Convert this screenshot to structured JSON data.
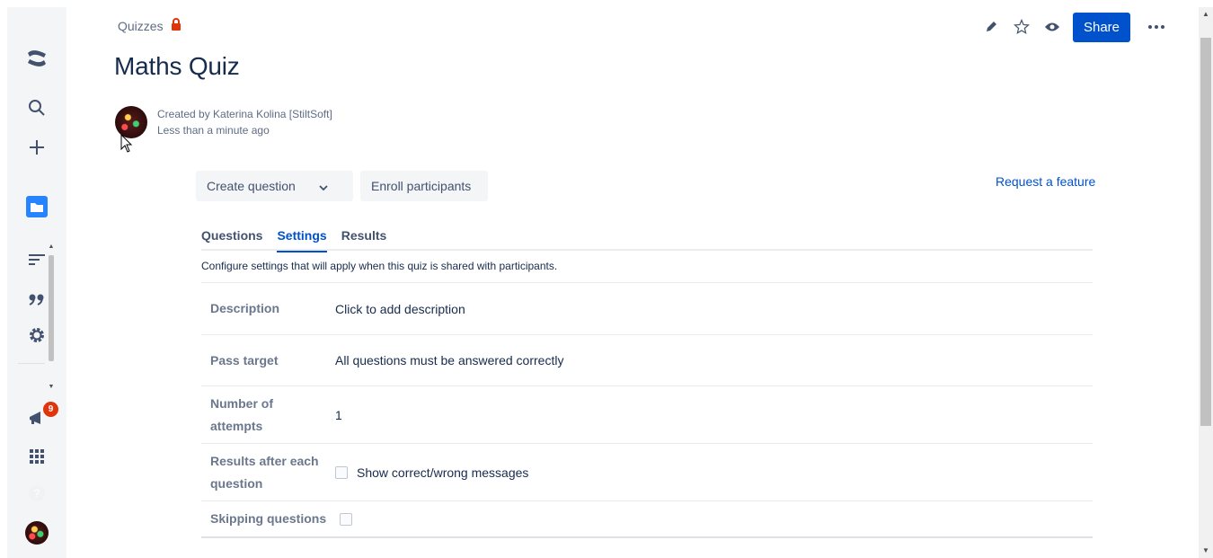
{
  "breadcrumb": {
    "space": "Quizzes"
  },
  "page": {
    "title": "Maths Quiz"
  },
  "byline": {
    "created_by": "Created by Katerina Kolina [StiltSoft]",
    "time": "Less than a minute ago"
  },
  "actions": {
    "share_label": "Share"
  },
  "nav": {
    "notification_count": "9"
  },
  "quiz_toolbar": {
    "create_question_label": "Create question",
    "enroll_label": "Enroll participants",
    "request_feature_label": "Request a feature"
  },
  "tabs": [
    {
      "label": "Questions"
    },
    {
      "label": "Settings",
      "active": true
    },
    {
      "label": "Results"
    }
  ],
  "settings_note": "Configure settings that will apply when this quiz is shared with participants.",
  "settings": {
    "description": {
      "label": "Description",
      "value": "Click to add description"
    },
    "pass_target": {
      "label": "Pass target",
      "value": "All questions must be answered correctly"
    },
    "attempts": {
      "label": "Number of attempts",
      "value": "1"
    },
    "results_after": {
      "label": "Results after each question",
      "checkbox_label": "Show correct/wrong messages"
    },
    "skipping": {
      "label": "Skipping questions"
    }
  },
  "colors": {
    "primary": "#0052cc",
    "badge": "#de350b",
    "text": "#172b4d",
    "muted": "#6b778c"
  }
}
